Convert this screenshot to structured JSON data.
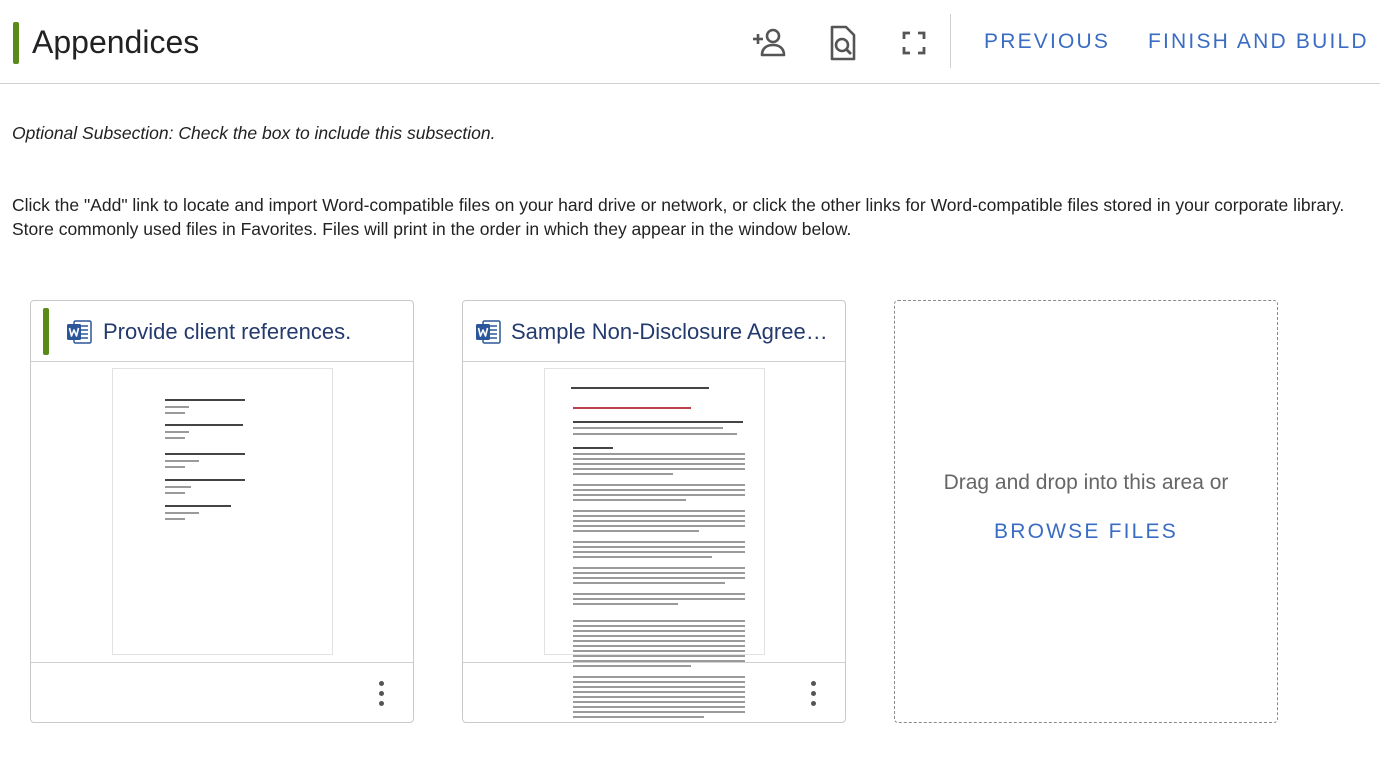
{
  "header": {
    "title": "Appendices",
    "icons": [
      "add-collaborator-icon",
      "preview-document-icon",
      "fullscreen-icon"
    ],
    "previous_label": "PREVIOUS",
    "finish_label": "FINISH AND BUILD"
  },
  "content": {
    "optional_note": "Optional Subsection: Check the box to include this subsection.",
    "instructions": "Click the \"Add\" link to locate and import Word-compatible files on your hard drive or network, or click the other links for Word-compatible files stored in your corporate library. Store commonly used files in Favorites. Files will print in the order in which they appear in the window below."
  },
  "cards": [
    {
      "title": "Provide client references.",
      "icon": "word-document-icon",
      "selected": true
    },
    {
      "title": "Sample Non-Disclosure Agreem...",
      "icon": "word-document-icon",
      "selected": false
    }
  ],
  "dropzone": {
    "text": "Drag and drop into this area or",
    "browse_label": "BROWSE FILES"
  },
  "colors": {
    "accent_green": "#5a8a1a",
    "link_blue": "#3a6cc4",
    "title_navy": "#243a6e",
    "word_blue": "#2b579a"
  }
}
